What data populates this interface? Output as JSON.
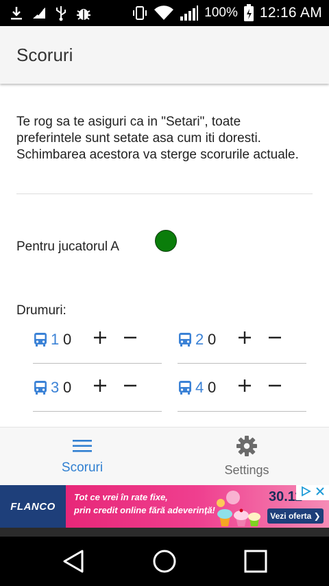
{
  "status_bar": {
    "battery_percent": "100%",
    "time": "12:16 AM",
    "icons": [
      "download-icon",
      "missed-call-icon",
      "usb-icon",
      "debug-bug-icon",
      "vibrate-icon",
      "wifi-icon",
      "signal-icon",
      "battery-icon"
    ]
  },
  "app_bar": {
    "title": "Scoruri"
  },
  "content": {
    "info_text": "Te rog sa te asiguri ca in \"Setari\", toate preferintele sunt setate asa cum iti doresti. Schimbarea acestora va sterge scorurile actuale.",
    "player_label": "Pentru jucatorul A",
    "player_color": "#0a7d0a",
    "roads_label": "Drumuri:",
    "steppers": [
      {
        "index": "1",
        "value": "0",
        "plus": "+",
        "minus": "−"
      },
      {
        "index": "2",
        "value": "0",
        "plus": "+",
        "minus": "−"
      },
      {
        "index": "3",
        "value": "0",
        "plus": "+",
        "minus": "−"
      },
      {
        "index": "4",
        "value": "0",
        "plus": "+",
        "minus": "−"
      }
    ]
  },
  "bottom_nav": {
    "items": [
      {
        "label": "Scoruri",
        "icon": "menu-icon",
        "active": true
      },
      {
        "label": "Settings",
        "icon": "gear-icon",
        "active": false
      }
    ],
    "accent_color": "#2f7fd1"
  },
  "ad": {
    "brand": "FLANCO",
    "text_line1": "Tot ce vrei în rate fixe,",
    "text_line2": "prin credit online fără adeverință!",
    "date": "30.11-",
    "cta": "Vezi oferta ❯"
  },
  "system_nav": {
    "icons": [
      "back-icon",
      "home-icon",
      "recents-icon"
    ]
  }
}
